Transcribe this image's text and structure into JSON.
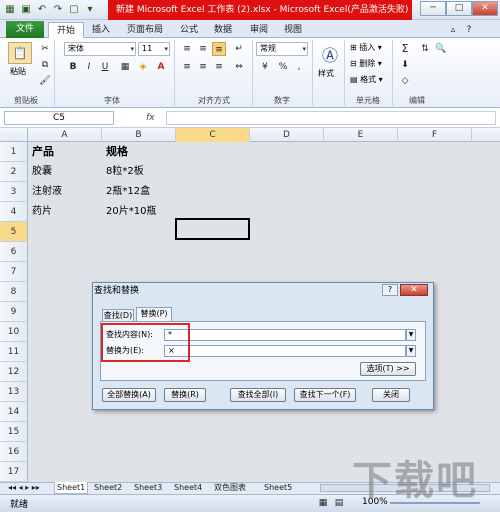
{
  "titlebar": {
    "title": "新建 Microsoft Excel 工作表 (2).xlsx - Microsoft Excel(产品激活失败)",
    "minimize": "─",
    "maximize": "□",
    "close": "✕"
  },
  "ribbon": {
    "file_tab": "文件",
    "tabs": [
      "开始",
      "插入",
      "页面布局",
      "公式",
      "数据",
      "审阅",
      "视图"
    ],
    "paste_label": "粘贴",
    "font_name": "宋体",
    "font_size": "11",
    "number_format": "常规",
    "style_label": "样式",
    "insert_label": "插入",
    "delete_label": "删除",
    "format_label": "格式",
    "groups": [
      "剪贴板",
      "字体",
      "对齐方式",
      "数字",
      "单元格",
      "编辑"
    ],
    "bold": "B",
    "italic": "I",
    "underline": "U",
    "sum": "Σ",
    "percent": "%",
    "comma": ","
  },
  "formula_bar": {
    "name_box": "C5",
    "fx": "fx",
    "value": ""
  },
  "columns": [
    "A",
    "B",
    "C",
    "D",
    "E",
    "F"
  ],
  "rows": [
    "1",
    "2",
    "3",
    "4",
    "5",
    "6",
    "7",
    "8",
    "9",
    "10",
    "11",
    "12",
    "13",
    "14",
    "15",
    "16",
    "17"
  ],
  "cells": {
    "A1": "产品",
    "B1": "规格",
    "A2": "胶囊",
    "B2": "8粒*2板",
    "A3": "注射液",
    "B3": "2瓶*12盒",
    "A4": "药片",
    "B4": "20片*10瓶"
  },
  "dialog": {
    "title": "查找和替换",
    "help": "?",
    "close": "✕",
    "tab_find": "查找(D)",
    "tab_replace": "替换(P)",
    "find_label": "查找内容(N):",
    "find_value": "*",
    "replace_label": "替换为(E):",
    "replace_value": "×",
    "options_button": "选项(T) >>",
    "buttons": {
      "replace_all": "全部替换(A)",
      "replace": "替换(R)",
      "find_all": "查找全部(I)",
      "find_next": "查找下一个(F)",
      "close": "关闭"
    }
  },
  "sheets": [
    "Sheet1",
    "Sheet2",
    "Sheet3",
    "Sheet4",
    "双色图表",
    "Sheet5"
  ],
  "status": {
    "ready": "就绪",
    "zoom": "100%"
  },
  "watermark": "下载吧"
}
